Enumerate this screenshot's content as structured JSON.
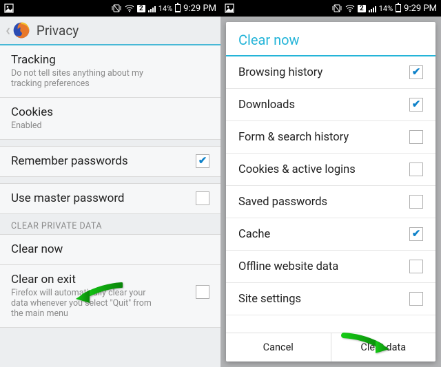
{
  "status": {
    "battery": "14%",
    "time": "9:29 PM",
    "carrier_badge": "2"
  },
  "screen1": {
    "title": "Privacy",
    "items": {
      "tracking": {
        "title": "Tracking",
        "sub": "Do not tell sites anything about my tracking preferences"
      },
      "cookies": {
        "title": "Cookies",
        "sub": "Enabled"
      },
      "remember": {
        "title": "Remember passwords",
        "checked": true
      },
      "master": {
        "title": "Use master password",
        "checked": false
      },
      "section": "CLEAR PRIVATE DATA",
      "clear_now": {
        "title": "Clear now"
      },
      "clear_exit": {
        "title": "Clear on exit",
        "sub": "Firefox will automatically clear your data whenever you select \"Quit\" from the main menu",
        "checked": false
      }
    }
  },
  "screen2": {
    "dialog_title": "Clear now",
    "options": [
      {
        "label": "Browsing history",
        "checked": true
      },
      {
        "label": "Downloads",
        "checked": true
      },
      {
        "label": "Form & search history",
        "checked": false
      },
      {
        "label": "Cookies & active logins",
        "checked": false
      },
      {
        "label": "Saved passwords",
        "checked": false
      },
      {
        "label": "Cache",
        "checked": true
      },
      {
        "label": "Offline website data",
        "checked": false
      },
      {
        "label": "Site settings",
        "checked": false
      }
    ],
    "buttons": {
      "cancel": "Cancel",
      "clear": "Clear data"
    }
  }
}
